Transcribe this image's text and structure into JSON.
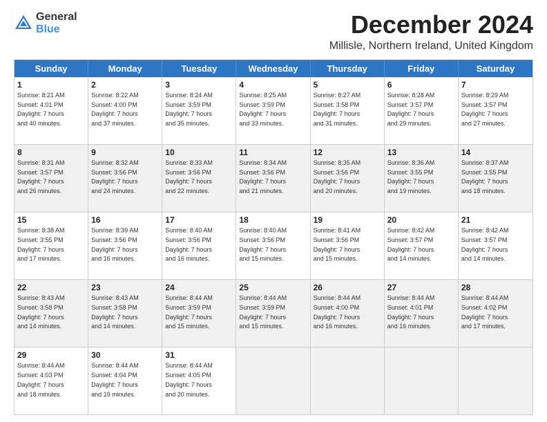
{
  "logo": {
    "general": "General",
    "blue": "Blue"
  },
  "title": "December 2024",
  "subtitle": "Millisle, Northern Ireland, United Kingdom",
  "headers": [
    "Sunday",
    "Monday",
    "Tuesday",
    "Wednesday",
    "Thursday",
    "Friday",
    "Saturday"
  ],
  "weeks": [
    [
      {
        "day": "1",
        "lines": [
          "Sunrise: 8:21 AM",
          "Sunset: 4:01 PM",
          "Daylight: 7 hours",
          "and 40 minutes."
        ],
        "shaded": false
      },
      {
        "day": "2",
        "lines": [
          "Sunrise: 8:22 AM",
          "Sunset: 4:00 PM",
          "Daylight: 7 hours",
          "and 37 minutes."
        ],
        "shaded": false
      },
      {
        "day": "3",
        "lines": [
          "Sunrise: 8:24 AM",
          "Sunset: 3:59 PM",
          "Daylight: 7 hours",
          "and 35 minutes."
        ],
        "shaded": false
      },
      {
        "day": "4",
        "lines": [
          "Sunrise: 8:25 AM",
          "Sunset: 3:59 PM",
          "Daylight: 7 hours",
          "and 33 minutes."
        ],
        "shaded": false
      },
      {
        "day": "5",
        "lines": [
          "Sunrise: 8:27 AM",
          "Sunset: 3:58 PM",
          "Daylight: 7 hours",
          "and 31 minutes."
        ],
        "shaded": false
      },
      {
        "day": "6",
        "lines": [
          "Sunrise: 8:28 AM",
          "Sunset: 3:57 PM",
          "Daylight: 7 hours",
          "and 29 minutes."
        ],
        "shaded": false
      },
      {
        "day": "7",
        "lines": [
          "Sunrise: 8:29 AM",
          "Sunset: 3:57 PM",
          "Daylight: 7 hours",
          "and 27 minutes."
        ],
        "shaded": false
      }
    ],
    [
      {
        "day": "8",
        "lines": [
          "Sunrise: 8:31 AM",
          "Sunset: 3:57 PM",
          "Daylight: 7 hours",
          "and 26 minutes."
        ],
        "shaded": true
      },
      {
        "day": "9",
        "lines": [
          "Sunrise: 8:32 AM",
          "Sunset: 3:56 PM",
          "Daylight: 7 hours",
          "and 24 minutes."
        ],
        "shaded": true
      },
      {
        "day": "10",
        "lines": [
          "Sunrise: 8:33 AM",
          "Sunset: 3:56 PM",
          "Daylight: 7 hours",
          "and 22 minutes."
        ],
        "shaded": true
      },
      {
        "day": "11",
        "lines": [
          "Sunrise: 8:34 AM",
          "Sunset: 3:56 PM",
          "Daylight: 7 hours",
          "and 21 minutes."
        ],
        "shaded": true
      },
      {
        "day": "12",
        "lines": [
          "Sunrise: 8:35 AM",
          "Sunset: 3:56 PM",
          "Daylight: 7 hours",
          "and 20 minutes."
        ],
        "shaded": true
      },
      {
        "day": "13",
        "lines": [
          "Sunrise: 8:36 AM",
          "Sunset: 3:55 PM",
          "Daylight: 7 hours",
          "and 19 minutes."
        ],
        "shaded": true
      },
      {
        "day": "14",
        "lines": [
          "Sunrise: 8:37 AM",
          "Sunset: 3:55 PM",
          "Daylight: 7 hours",
          "and 18 minutes."
        ],
        "shaded": true
      }
    ],
    [
      {
        "day": "15",
        "lines": [
          "Sunrise: 8:38 AM",
          "Sunset: 3:55 PM",
          "Daylight: 7 hours",
          "and 17 minutes."
        ],
        "shaded": false
      },
      {
        "day": "16",
        "lines": [
          "Sunrise: 8:39 AM",
          "Sunset: 3:56 PM",
          "Daylight: 7 hours",
          "and 16 minutes."
        ],
        "shaded": false
      },
      {
        "day": "17",
        "lines": [
          "Sunrise: 8:40 AM",
          "Sunset: 3:56 PM",
          "Daylight: 7 hours",
          "and 16 minutes."
        ],
        "shaded": false
      },
      {
        "day": "18",
        "lines": [
          "Sunrise: 8:40 AM",
          "Sunset: 3:56 PM",
          "Daylight: 7 hours",
          "and 15 minutes."
        ],
        "shaded": false
      },
      {
        "day": "19",
        "lines": [
          "Sunrise: 8:41 AM",
          "Sunset: 3:56 PM",
          "Daylight: 7 hours",
          "and 15 minutes."
        ],
        "shaded": false
      },
      {
        "day": "20",
        "lines": [
          "Sunrise: 8:42 AM",
          "Sunset: 3:57 PM",
          "Daylight: 7 hours",
          "and 14 minutes."
        ],
        "shaded": false
      },
      {
        "day": "21",
        "lines": [
          "Sunrise: 8:42 AM",
          "Sunset: 3:57 PM",
          "Daylight: 7 hours",
          "and 14 minutes."
        ],
        "shaded": false
      }
    ],
    [
      {
        "day": "22",
        "lines": [
          "Sunrise: 8:43 AM",
          "Sunset: 3:58 PM",
          "Daylight: 7 hours",
          "and 14 minutes."
        ],
        "shaded": true
      },
      {
        "day": "23",
        "lines": [
          "Sunrise: 8:43 AM",
          "Sunset: 3:58 PM",
          "Daylight: 7 hours",
          "and 14 minutes."
        ],
        "shaded": true
      },
      {
        "day": "24",
        "lines": [
          "Sunrise: 8:44 AM",
          "Sunset: 3:59 PM",
          "Daylight: 7 hours",
          "and 15 minutes."
        ],
        "shaded": true
      },
      {
        "day": "25",
        "lines": [
          "Sunrise: 8:44 AM",
          "Sunset: 3:59 PM",
          "Daylight: 7 hours",
          "and 15 minutes."
        ],
        "shaded": true
      },
      {
        "day": "26",
        "lines": [
          "Sunrise: 8:44 AM",
          "Sunset: 4:00 PM",
          "Daylight: 7 hours",
          "and 16 minutes."
        ],
        "shaded": true
      },
      {
        "day": "27",
        "lines": [
          "Sunrise: 8:44 AM",
          "Sunset: 4:01 PM",
          "Daylight: 7 hours",
          "and 16 minutes."
        ],
        "shaded": true
      },
      {
        "day": "28",
        "lines": [
          "Sunrise: 8:44 AM",
          "Sunset: 4:02 PM",
          "Daylight: 7 hours",
          "and 17 minutes."
        ],
        "shaded": true
      }
    ],
    [
      {
        "day": "29",
        "lines": [
          "Sunrise: 8:44 AM",
          "Sunset: 4:03 PM",
          "Daylight: 7 hours",
          "and 18 minutes."
        ],
        "shaded": false
      },
      {
        "day": "30",
        "lines": [
          "Sunrise: 8:44 AM",
          "Sunset: 4:04 PM",
          "Daylight: 7 hours",
          "and 19 minutes."
        ],
        "shaded": false
      },
      {
        "day": "31",
        "lines": [
          "Sunrise: 8:44 AM",
          "Sunset: 4:05 PM",
          "Daylight: 7 hours",
          "and 20 minutes."
        ],
        "shaded": false
      },
      {
        "day": "",
        "lines": [],
        "shaded": true,
        "empty": true
      },
      {
        "day": "",
        "lines": [],
        "shaded": true,
        "empty": true
      },
      {
        "day": "",
        "lines": [],
        "shaded": true,
        "empty": true
      },
      {
        "day": "",
        "lines": [],
        "shaded": true,
        "empty": true
      }
    ]
  ]
}
